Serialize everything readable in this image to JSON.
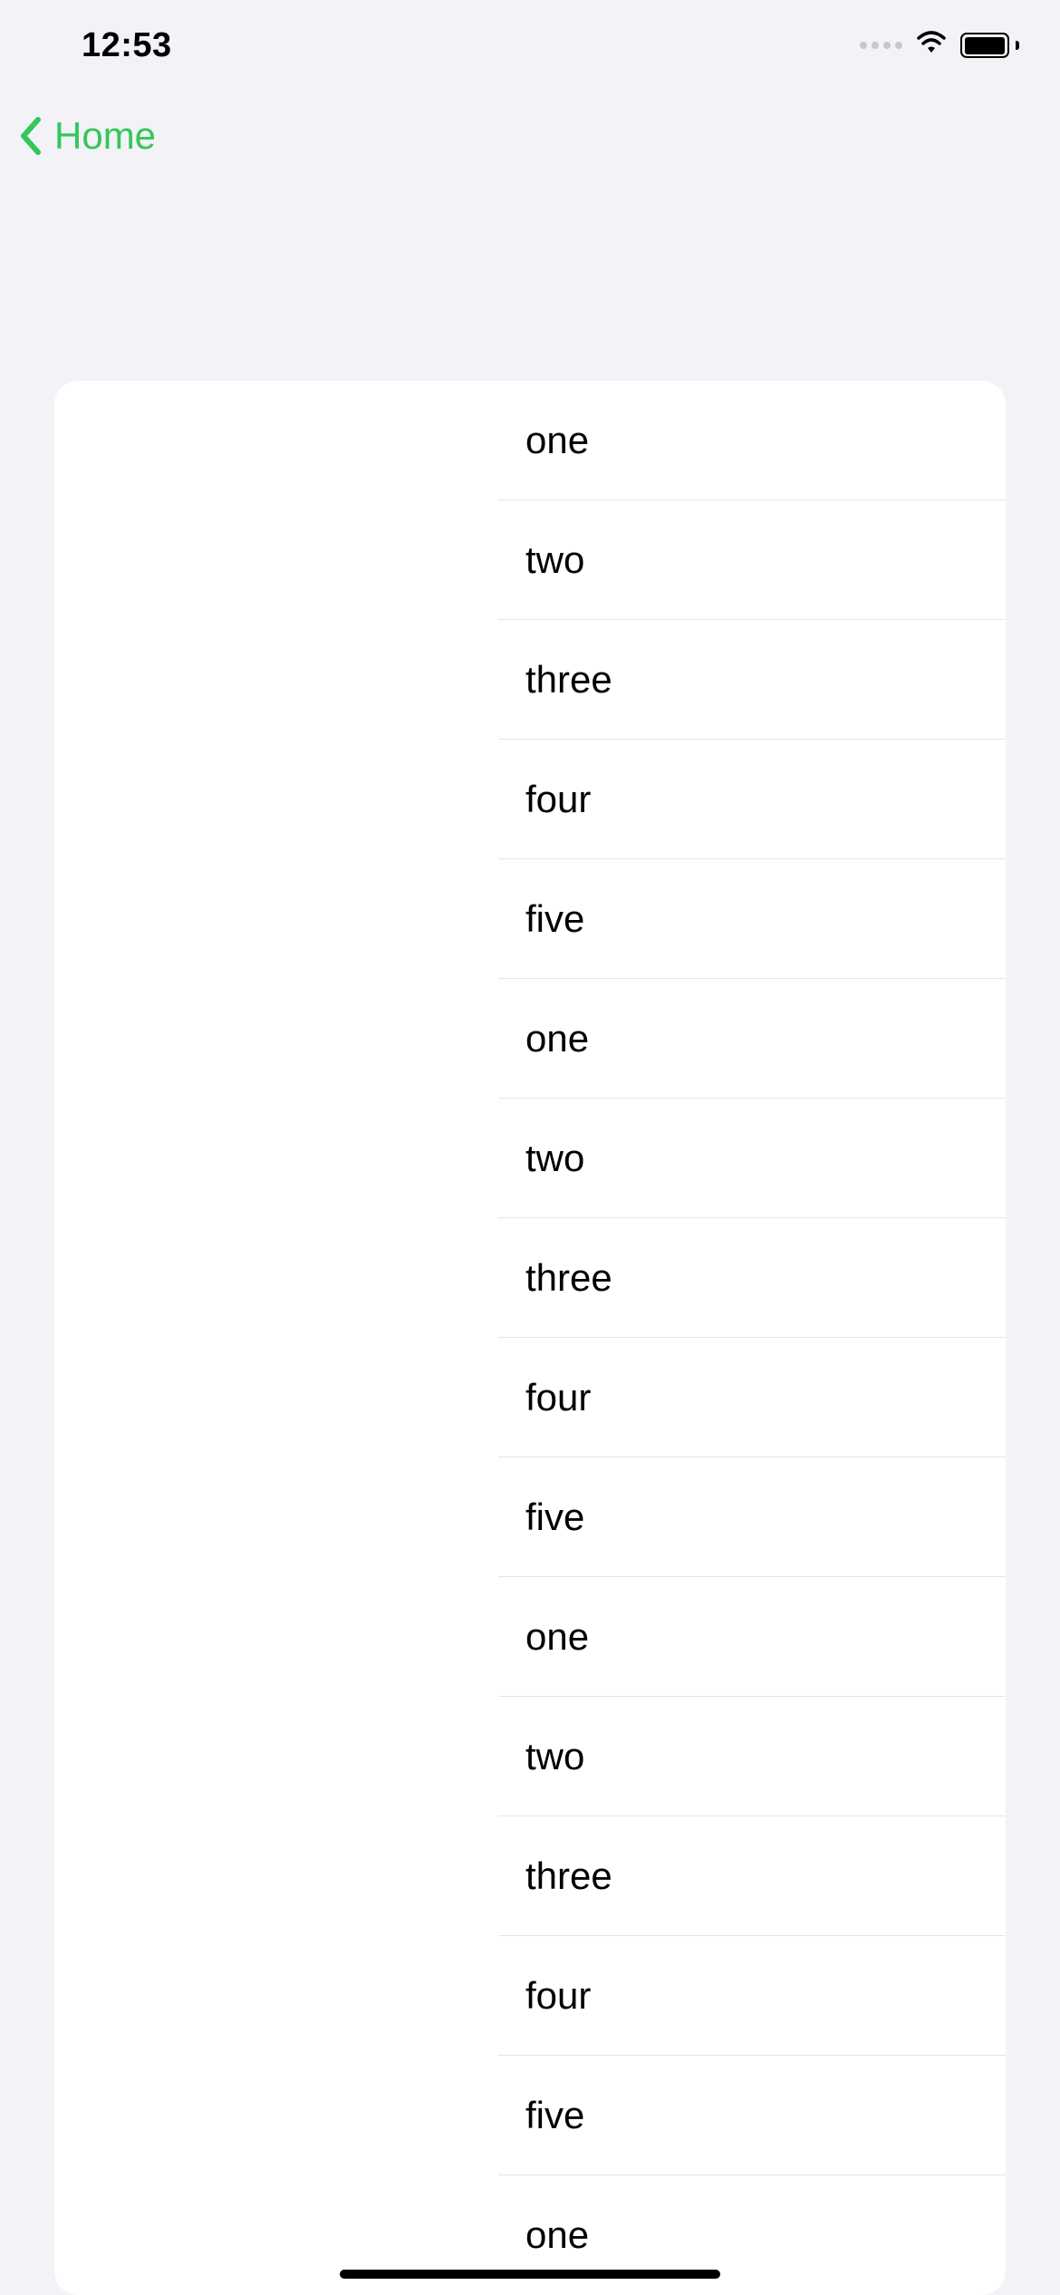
{
  "status": {
    "time": "12:53"
  },
  "nav": {
    "back_label": "Home"
  },
  "list": {
    "items": [
      {
        "label": "one"
      },
      {
        "label": "two"
      },
      {
        "label": "three"
      },
      {
        "label": "four"
      },
      {
        "label": "five"
      },
      {
        "label": "one"
      },
      {
        "label": "two"
      },
      {
        "label": "three"
      },
      {
        "label": "four"
      },
      {
        "label": "five"
      },
      {
        "label": "one"
      },
      {
        "label": "two"
      },
      {
        "label": "three"
      },
      {
        "label": "four"
      },
      {
        "label": "five"
      },
      {
        "label": "one"
      }
    ]
  }
}
